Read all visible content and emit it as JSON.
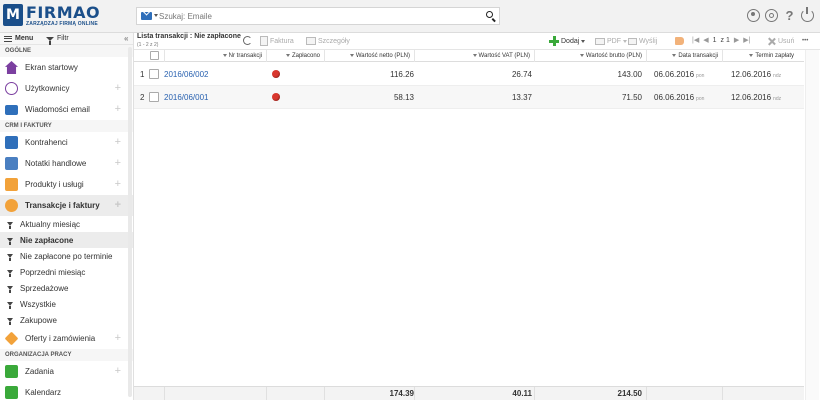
{
  "brand": {
    "logo_letter": "M",
    "name": "FIRMAO",
    "tagline": "ZARZĄDZAJ FIRMĄ ONLINE"
  },
  "search": {
    "placeholder": "Szukaj: Emaile"
  },
  "header_icons": [
    "user-icon",
    "settings-icon",
    "help-icon",
    "power-icon"
  ],
  "sidebar": {
    "menu_label": "Menu",
    "filter_label": "Filtr",
    "collapse": "«",
    "sections": {
      "general": "OGÓLNE",
      "crm": "CRM I FAKTURY",
      "work": "ORGANIZACJA PRACY"
    },
    "items": {
      "start": "Ekran startowy",
      "users": "Użytkownicy",
      "email": "Wiadomości email",
      "contractors": "Kontrahenci",
      "notes": "Notatki handlowe",
      "products": "Produkty i usługi",
      "transactions": "Transakcje i faktury",
      "offers": "Oferty i zamówienia",
      "tasks": "Zadania",
      "calendar": "Kalendarz"
    },
    "filters": [
      "Aktualny miesiąc",
      "Nie zapłacone",
      "Nie zapłacone po terminie",
      "Poprzedni miesiąc",
      "Sprzedażowe",
      "Wszystkie",
      "Zakupowe"
    ],
    "colors": {
      "start": "#7b3fa0",
      "users": "#7b3fa0",
      "email": "#2f6fba",
      "contractors": "#2f6fba",
      "notes": "#4a7fc1",
      "products": "#f2a23a",
      "transactions": "#f2a23a",
      "offers": "#f2a23a",
      "tasks": "#3aa93a",
      "calendar": "#3aa93a"
    }
  },
  "toolbar": {
    "title": "Lista transakcji : Nie zapłacone",
    "count": "(1 - 2 z 2)",
    "invoice": "Faktura",
    "details": "Szczegóły",
    "add": "Dodaj",
    "pdf": "PDF",
    "send": "Wyślij",
    "page_current": "1",
    "page_of": "z 1",
    "delete": "Usuń",
    "more": "•••"
  },
  "table": {
    "headers": {
      "nr": "Nr transakcji",
      "paid": "Zapłacono",
      "net": "Wartość netto (PLN)",
      "vat": "Wartość VAT (PLN)",
      "gross": "Wartość brutto (PLN)",
      "date": "Data transakcji",
      "due": "Termin zapłaty"
    },
    "rows": [
      {
        "idx": "1",
        "nr": "2016/06/002",
        "net": "116.26",
        "vat": "26.74",
        "gross": "143.00",
        "date": "06.06.2016",
        "date_day": "pon",
        "due": "12.06.2016",
        "due_day": "ndz"
      },
      {
        "idx": "2",
        "nr": "2016/06/001",
        "net": "58.13",
        "vat": "13.37",
        "gross": "71.50",
        "date": "06.06.2016",
        "date_day": "pon",
        "due": "12.06.2016",
        "due_day": "ndz"
      }
    ],
    "totals": {
      "net": "174.39",
      "vat": "40.11",
      "gross": "214.50"
    },
    "paid_status_color": "#d9372e"
  }
}
